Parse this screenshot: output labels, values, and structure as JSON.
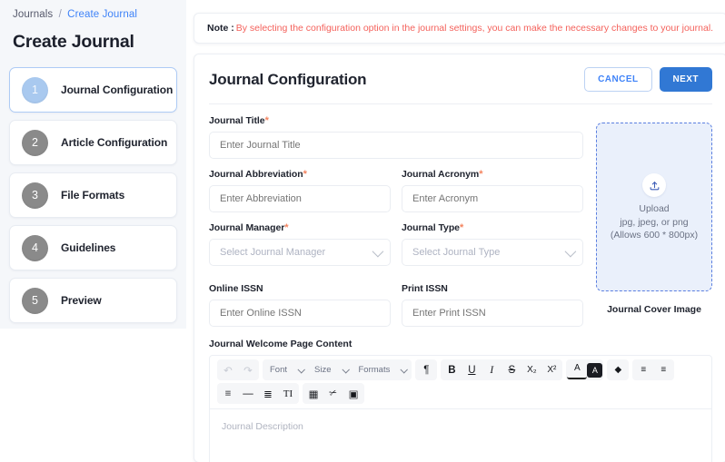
{
  "breadcrumb": {
    "root": "Journals",
    "separator": "/",
    "current": "Create Journal"
  },
  "page_title": "Create Journal",
  "steps": [
    {
      "number": "1",
      "label": "Journal Configuration",
      "active": true
    },
    {
      "number": "2",
      "label": "Article Configuration",
      "active": false
    },
    {
      "number": "3",
      "label": "File Formats",
      "active": false
    },
    {
      "number": "4",
      "label": "Guidelines",
      "active": false
    },
    {
      "number": "5",
      "label": "Preview",
      "active": false
    }
  ],
  "note": {
    "label": "Note :",
    "text": "By selecting the configuration option in the journal settings, you can make the necessary changes to your journal.",
    "text_color": "#f4615b"
  },
  "card": {
    "title": "Journal Configuration",
    "cancel_label": "CANCEL",
    "next_label": "NEXT",
    "accent_color": "#3178d4"
  },
  "form": {
    "journal_title": {
      "label": "Journal Title",
      "required": "*",
      "value": "",
      "placeholder": "Enter Journal Title"
    },
    "journal_abbreviation": {
      "label": "Journal Abbreviation",
      "required": "*",
      "value": "",
      "placeholder": "Enter Abbreviation"
    },
    "journal_acronym": {
      "label": "Journal Acronym",
      "required": "*",
      "value": "",
      "placeholder": "Enter Acronym"
    },
    "journal_manager": {
      "label": "Journal Manager",
      "required": "*",
      "value": "",
      "placeholder": "Select Journal Manager"
    },
    "journal_type": {
      "label": "Journal Type",
      "required": "*",
      "value": "",
      "placeholder": "Select Journal Type"
    },
    "online_issn": {
      "label": "Online ISSN",
      "required": "",
      "value": "",
      "placeholder": "Enter Online ISSN"
    },
    "print_issn": {
      "label": "Print ISSN",
      "required": "",
      "value": "",
      "placeholder": "Enter Print ISSN"
    }
  },
  "cover": {
    "upload_label": "Upload",
    "file_types": "jpg, jpeg, or png",
    "dimensions": "(Allows 600 * 800px)",
    "caption": "Journal Cover Image",
    "border_color": "#5b7fe0",
    "fill_color": "#eaf0fb"
  },
  "editor": {
    "label": "Journal Welcome Page Content",
    "placeholder": "Journal Description",
    "toolbar_row1": [
      {
        "name": "undo-icon",
        "glyph": "↶",
        "dim": true
      },
      {
        "name": "redo-icon",
        "glyph": "↷",
        "dim": true
      }
    ],
    "selects": [
      {
        "name": "font-select",
        "label": "Font"
      },
      {
        "name": "size-select",
        "label": "Size"
      },
      {
        "name": "formats-select",
        "label": "Formats"
      }
    ],
    "format_buttons": [
      {
        "name": "paragraph-icon",
        "glyph": "¶"
      },
      {
        "name": "bold-icon",
        "glyph": "B"
      },
      {
        "name": "underline-icon",
        "glyph": "U"
      },
      {
        "name": "italic-icon",
        "glyph": "I"
      },
      {
        "name": "strikethrough-icon",
        "glyph": "S"
      },
      {
        "name": "subscript-icon",
        "glyph": "X₂"
      },
      {
        "name": "superscript-icon",
        "glyph": "X²"
      }
    ],
    "color_buttons": [
      {
        "name": "text-color-icon",
        "glyph": "A"
      },
      {
        "name": "background-color-icon",
        "glyph": "A"
      }
    ],
    "clear_button": {
      "name": "clear-formatting-icon",
      "glyph": "◆"
    },
    "indent_buttons": [
      {
        "name": "indent-increase-icon",
        "glyph": "≡"
      },
      {
        "name": "indent-decrease-icon",
        "glyph": "≡"
      }
    ],
    "toolbar_row2_a": [
      {
        "name": "align-left-icon",
        "glyph": "≡"
      },
      {
        "name": "horizontal-rule-icon",
        "glyph": "—"
      },
      {
        "name": "numbered-list-icon",
        "glyph": "≣"
      },
      {
        "name": "text-direction-icon",
        "glyph": "TI"
      }
    ],
    "toolbar_row2_b": [
      {
        "name": "table-icon",
        "glyph": "▦"
      },
      {
        "name": "unlink-icon",
        "glyph": "✂"
      },
      {
        "name": "insert-image-icon",
        "glyph": "▣"
      }
    ]
  }
}
